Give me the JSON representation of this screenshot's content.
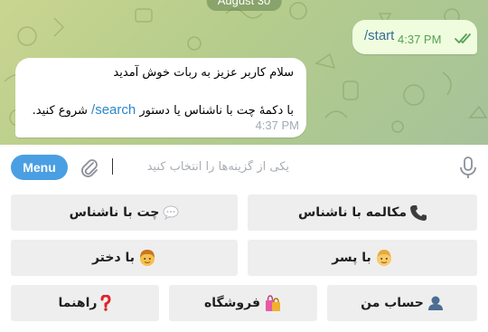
{
  "chat": {
    "date_label": "August 30",
    "outgoing": {
      "text": "/start",
      "time": "4:37 PM",
      "status_icon": "double-check-icon"
    },
    "incoming": {
      "line1": "سلام کاربر عزیز به ربات خوش آمدید",
      "line2_prefix": "با دکمهٔ چت با ناشناس یا دستور",
      "command": "/search",
      "line2_suffix": "شروع کنید.",
      "time": "4:37 PM"
    }
  },
  "composer": {
    "menu_label": "Menu",
    "placeholder": "یکی از گزینه‌ها را انتخاب کنید",
    "attach_icon": "paperclip-icon",
    "mic_icon": "microphone-icon"
  },
  "keyboard": {
    "row1": [
      {
        "label": "مکالمه با ناشناس",
        "icon": "phone-icon"
      },
      {
        "label": "چت با ناشناس",
        "icon": "speech-bubble-icon"
      }
    ],
    "row2": [
      {
        "label": "با پسر",
        "icon": "boy-face-icon"
      },
      {
        "label": "با دختر",
        "icon": "girl-face-icon"
      }
    ],
    "row3": [
      {
        "label": "حساب من",
        "icon": "user-icon"
      },
      {
        "label": "فروشگاه",
        "icon": "shopping-bags-icon"
      },
      {
        "label": "راهنما",
        "icon": "question-mark-icon"
      }
    ]
  },
  "colors": {
    "chat_background": "#c9d590",
    "outgoing_bubble": "#effdde",
    "incoming_bubble": "#ffffff",
    "menu_button": "#4a9fe3",
    "link": "#2b88c9",
    "keyboard_button": "#eeeeee"
  }
}
